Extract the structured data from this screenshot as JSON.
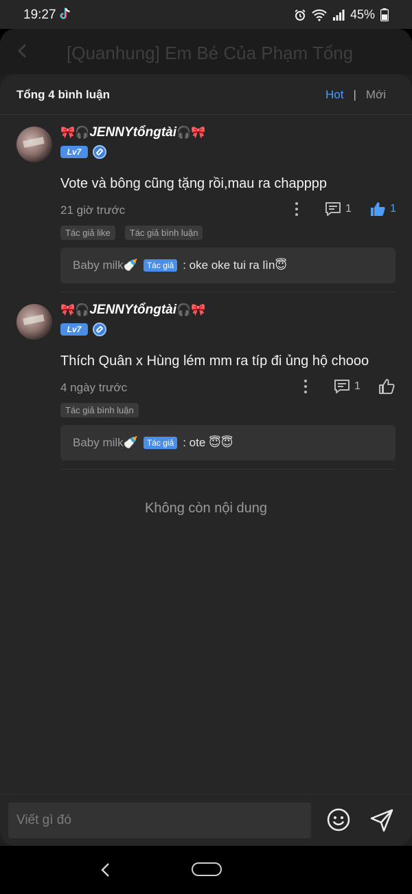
{
  "status_bar": {
    "time": "19:27",
    "battery": "45%"
  },
  "page": {
    "title": "[Quanhung] Em Bé Của Phạm Tổng"
  },
  "comments_header": {
    "total_label": "Tổng 4 bình luận",
    "sort_hot": "Hot",
    "separator": "|",
    "sort_new": "Mới"
  },
  "comments": [
    {
      "username": "JENNYtổngtài",
      "level": "Lv7",
      "text": "Vote và bông cũng tặng rồi,mau ra chapppp",
      "time": "21 giờ trước",
      "reply_count": "1",
      "like_count": "1",
      "tags": [
        "Tác giả like",
        "Tác giả bình luận"
      ],
      "reply": {
        "author": "Baby milk🍼",
        "author_tag": "Tác giả",
        "body": ": oke oke tui ra lìn😇"
      }
    },
    {
      "username": "JENNYtổngtài",
      "level": "Lv7",
      "text": "Thích Quân x Hùng lém mm ra típ đi ủng hộ chooo",
      "time": "4 ngày trước",
      "reply_count": "1",
      "like_count": "",
      "tags": [
        "Tác giả bình luận"
      ],
      "reply": {
        "author": "Baby milk🍼",
        "author_tag": "Tác giả",
        "body": ": ote 😇😇"
      }
    }
  ],
  "empty_message": "Không còn nội dung",
  "composer": {
    "placeholder": "Viết gì đó"
  },
  "icons": {
    "back": "chevron-left-icon",
    "more": "more-vertical-icon",
    "reply": "comment-icon",
    "like": "thumbs-up-icon",
    "emoji": "smiley-icon",
    "send": "send-icon"
  },
  "colors": {
    "accent": "#4a9eff",
    "level_badge": "#4a8ee8",
    "sheet": "#262626"
  }
}
